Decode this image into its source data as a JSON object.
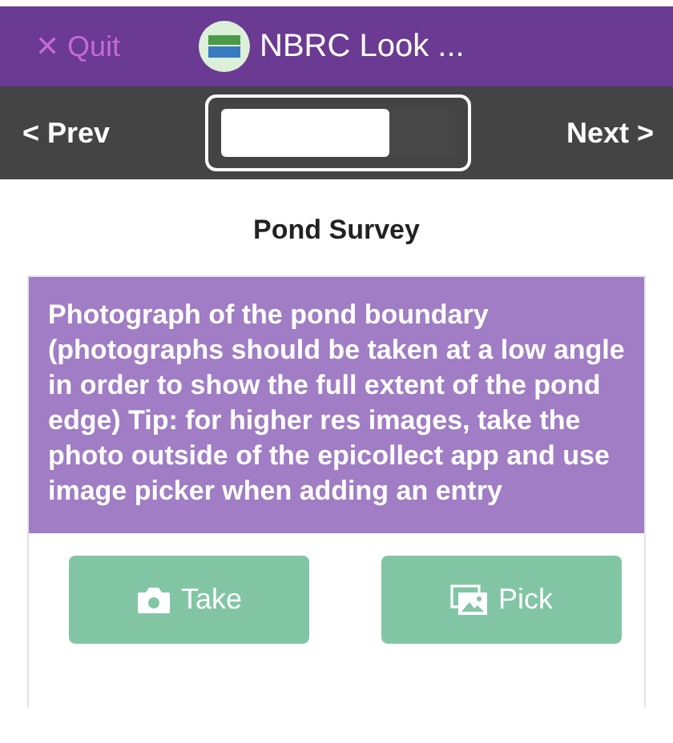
{
  "header": {
    "quit": "✕ Quit",
    "title": "NBRC Look ..."
  },
  "nav": {
    "prev": "< Prev",
    "next": "Next >",
    "progress": {
      "level": 0.72
    }
  },
  "form_title": "Pond Survey",
  "question": {
    "text": "Photograph of the pond boundary (photographs should be taken at a low angle in order to show the full extent of the pond edge) Tip: for higher res images, take the photo outside of the epicollect app and use image picker when adding an entry"
  },
  "buttons": [
    {
      "kind": "camera",
      "label": "Take"
    },
    {
      "kind": "gallery",
      "label": "Pick"
    }
  ]
}
